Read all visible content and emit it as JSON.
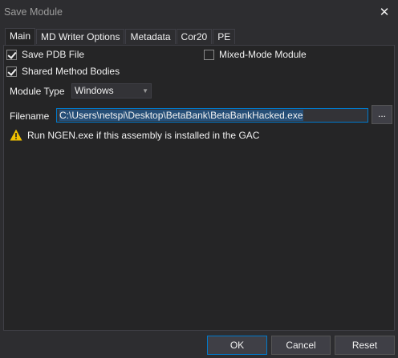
{
  "window": {
    "title": "Save Module",
    "close_glyph": "✕"
  },
  "tabs": [
    {
      "label": "Main",
      "active": true
    },
    {
      "label": "MD Writer Options"
    },
    {
      "label": "Metadata"
    },
    {
      "label": "Cor20"
    },
    {
      "label": "PE"
    }
  ],
  "main": {
    "save_pdb": {
      "label": "Save PDB File",
      "checked": true
    },
    "mixed_mode": {
      "label": "Mixed-Mode Module",
      "checked": false
    },
    "shared_bodies": {
      "label": "Shared Method Bodies",
      "checked": true
    },
    "module_type_label": "Module Type",
    "module_type_value": "Windows",
    "filename_label": "Filename",
    "filename_value": "C:\\Users\\netspi\\Desktop\\BetaBank\\BetaBankHacked.exe",
    "browse_label": "...",
    "warning_text": "Run NGEN.exe if this assembly is installed in the GAC"
  },
  "buttons": {
    "ok": "OK",
    "cancel": "Cancel",
    "reset": "Reset"
  },
  "colors": {
    "background": "#2d2d30",
    "panel": "#252526",
    "accent": "#007acc",
    "warning": "#f0c000"
  }
}
